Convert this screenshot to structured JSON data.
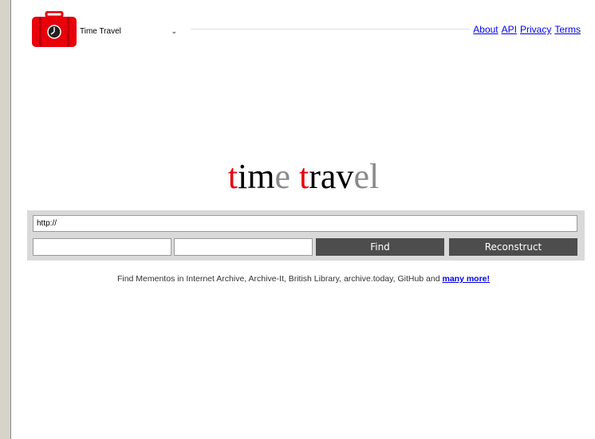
{
  "header": {
    "service_select": {
      "value": "Time Travel"
    },
    "links": [
      "About",
      "API",
      "Privacy",
      "Terms"
    ]
  },
  "brand": {
    "letters": [
      {
        "text": "t",
        "tone": "red"
      },
      {
        "text": "im",
        "tone": "black"
      },
      {
        "text": "e",
        "tone": "grey"
      },
      {
        "text": " ",
        "tone": "black"
      },
      {
        "text": "t",
        "tone": "red"
      },
      {
        "text": "rav",
        "tone": "black"
      },
      {
        "text": "el",
        "tone": "grey"
      }
    ]
  },
  "form": {
    "url_value": "http://",
    "date_value_1": "",
    "date_value_2": "",
    "find_label": "Find",
    "reconstruct_label": "Reconstruct"
  },
  "tagline": {
    "text": "Find Mementos in Internet Archive, Archive-It, British Library, archive.today, GitHub and ",
    "link": "many more!"
  },
  "colors": {
    "accent_red": "#e8000b",
    "button_bg": "#4d4d4d",
    "panel_bg": "#d9d9d9",
    "link": "#0000ee"
  },
  "icons": {
    "logo": "suitcase-clock-icon",
    "select_arrow": "chevron-down-icon"
  }
}
